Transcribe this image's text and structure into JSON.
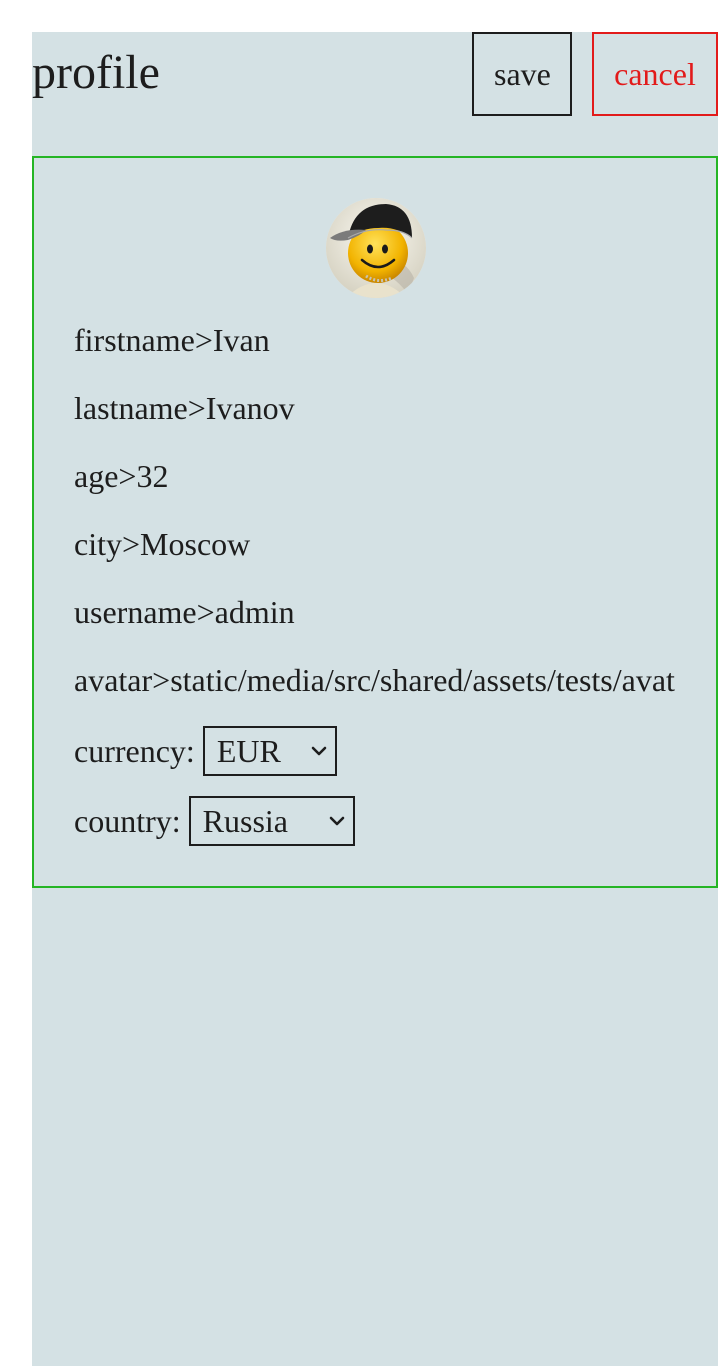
{
  "header": {
    "title": "profile",
    "save_label": "save",
    "cancel_label": "cancel"
  },
  "profile": {
    "avatar_icon": "smiley-cap-avatar",
    "fields": [
      {
        "label": "firstname",
        "value": "Ivan"
      },
      {
        "label": "lastname",
        "value": "Ivanov"
      },
      {
        "label": "age",
        "value": "32"
      },
      {
        "label": "city",
        "value": "Moscow"
      },
      {
        "label": "username",
        "value": "admin"
      },
      {
        "label": "avatar",
        "value": "static/media/src/shared/assets/tests/avat"
      }
    ],
    "separator": ">",
    "currency": {
      "label": "currency:",
      "selected": "EUR"
    },
    "country": {
      "label": "country:",
      "selected": "Russia"
    }
  },
  "colors": {
    "background": "#d4e1e4",
    "save_border": "#1d1d1d",
    "cancel": "#e21b1b",
    "card_border": "#25b525"
  }
}
